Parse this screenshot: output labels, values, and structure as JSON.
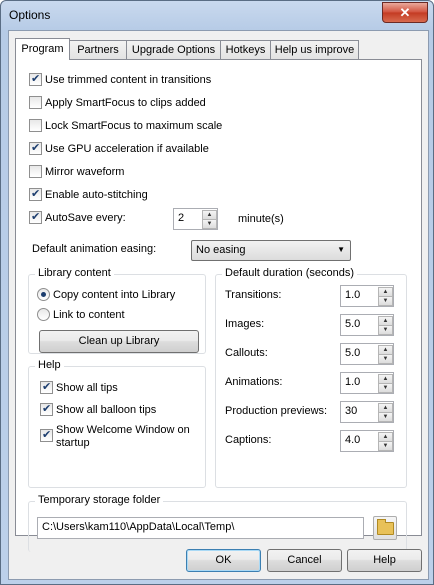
{
  "window": {
    "title": "Options",
    "close_label": "✕"
  },
  "tabs": [
    {
      "label": "Program"
    },
    {
      "label": "Partners"
    },
    {
      "label": "Upgrade Options"
    },
    {
      "label": "Hotkeys"
    },
    {
      "label": "Help us improve"
    }
  ],
  "options": [
    {
      "label": "Use trimmed content in transitions",
      "checked": true
    },
    {
      "label": "Apply SmartFocus to clips added",
      "checked": false
    },
    {
      "label": "Lock SmartFocus to maximum scale",
      "checked": false
    },
    {
      "label": "Use GPU acceleration if available",
      "checked": true
    },
    {
      "label": "Mirror waveform",
      "checked": false
    },
    {
      "label": "Enable auto-stitching",
      "checked": true
    }
  ],
  "autosave": {
    "label": "AutoSave every:",
    "checked": true,
    "value": "2",
    "unit": "minute(s)"
  },
  "easing": {
    "label": "Default animation easing:",
    "value": "No easing"
  },
  "library": {
    "title": "Library content",
    "copy_label": "Copy content into Library",
    "link_label": "Link to content",
    "selected": "copy",
    "cleanup_label": "Clean up Library"
  },
  "help": {
    "title": "Help",
    "items": [
      {
        "label": "Show all tips",
        "checked": true
      },
      {
        "label": "Show all balloon tips",
        "checked": true
      },
      {
        "label": "Show Welcome Window on",
        "label2": "startup",
        "checked": true
      }
    ]
  },
  "duration": {
    "title": "Default duration (seconds)",
    "items": [
      {
        "label": "Transitions:",
        "value": "1.0"
      },
      {
        "label": "Images:",
        "value": "5.0"
      },
      {
        "label": "Callouts:",
        "value": "5.0"
      },
      {
        "label": "Animations:",
        "value": "1.0"
      },
      {
        "label": "Production previews:",
        "value": "30"
      },
      {
        "label": "Captions:",
        "value": "4.0"
      }
    ]
  },
  "temp": {
    "title": "Temporary storage folder",
    "path": "C:\\Users\\kam110\\AppData\\Local\\Temp\\"
  },
  "buttons": {
    "ok": "OK",
    "cancel": "Cancel",
    "help": "Help"
  }
}
